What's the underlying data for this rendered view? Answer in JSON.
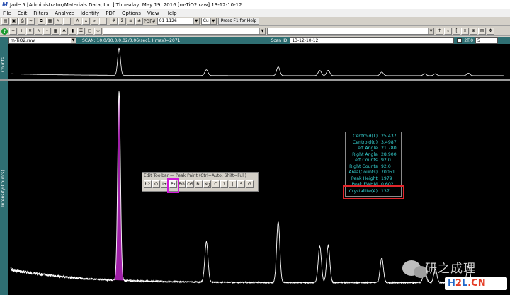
{
  "window": {
    "title": "Jade 5 [Administrator/Materials Data, Inc.] Thursday, May 19, 2016 [m-TiO2.raw] 13-12-10-12",
    "icon": "jade-app-icon"
  },
  "menu": [
    "File",
    "Edit",
    "Filters",
    "Analyze",
    "Identify",
    "PDF",
    "Options",
    "View",
    "Help"
  ],
  "toolbar": {
    "pdf_label": "PDF#",
    "pdf_value": "01-1126",
    "target_value": "Cu",
    "help_label": "Press F1 for Help"
  },
  "scan_bar": {
    "file": "m-TiO2.raw",
    "scan_info": "SCAN: 10.0/80.0/0.02/0.06(sec), I(max)=2071",
    "scan_id_label": "Scan ID",
    "scan_id": "13-12-10-12",
    "two_theta_label": "2T:0",
    "two_theta_value": "5"
  },
  "axis_labels": {
    "top": "Counts",
    "main": "Intensity(Counts)"
  },
  "edit_toolbar": {
    "title": "Edit Toolbar — Peak Paint (Ctrl=Auto, Shift=Full)",
    "buttons": [
      "b2",
      "Q",
      "I+",
      "Pk",
      "BG",
      "OS",
      "Br",
      "Ng",
      "C",
      "?",
      "|",
      "S",
      "G"
    ],
    "active_button": 3
  },
  "peak_report": {
    "rows": [
      {
        "label": "Centroid(T)",
        "value": "25.437"
      },
      {
        "label": "Centroid(d)",
        "value": "3.4987"
      },
      {
        "label": "Left Angle",
        "value": "21.780"
      },
      {
        "label": "Right Angle",
        "value": "28.900"
      },
      {
        "label": "Left Counts",
        "value": "92.0"
      },
      {
        "label": "Right Counts",
        "value": "92.0"
      },
      {
        "label": "Area(Counts)",
        "value": "70051"
      },
      {
        "label": "Peak Height",
        "value": "1979"
      },
      {
        "label": "Peak FWHM",
        "value": "0.602"
      },
      {
        "label": "Crystallite(A)",
        "value": "137"
      }
    ]
  },
  "colors": {
    "background": "#000000",
    "pattern": "#ffffff",
    "painted_peak": "#a020a8",
    "report_text": "#35d2d2",
    "highlight_box": "#e3262b",
    "active_tool_box": "#d018d8"
  },
  "chart_data": {
    "type": "line",
    "x_range": [
      10.0,
      80.0
    ],
    "y_max": 2071,
    "peaks": [
      {
        "two_theta": 25.4,
        "intensity": 1979,
        "painted": true
      },
      {
        "two_theta": 37.8,
        "intensity": 420
      },
      {
        "two_theta": 48.0,
        "intensity": 640
      },
      {
        "two_theta": 53.9,
        "intensity": 380
      },
      {
        "two_theta": 55.1,
        "intensity": 390
      },
      {
        "two_theta": 62.7,
        "intensity": 260
      },
      {
        "two_theta": 68.8,
        "intensity": 140
      },
      {
        "two_theta": 70.3,
        "intensity": 140
      },
      {
        "two_theta": 75.0,
        "intensity": 180
      }
    ]
  },
  "watermark": {
    "brand": "研之成理",
    "site_h": "H",
    "site_two": "2",
    "site_rest": "L",
    "site_dot": ".CN"
  }
}
